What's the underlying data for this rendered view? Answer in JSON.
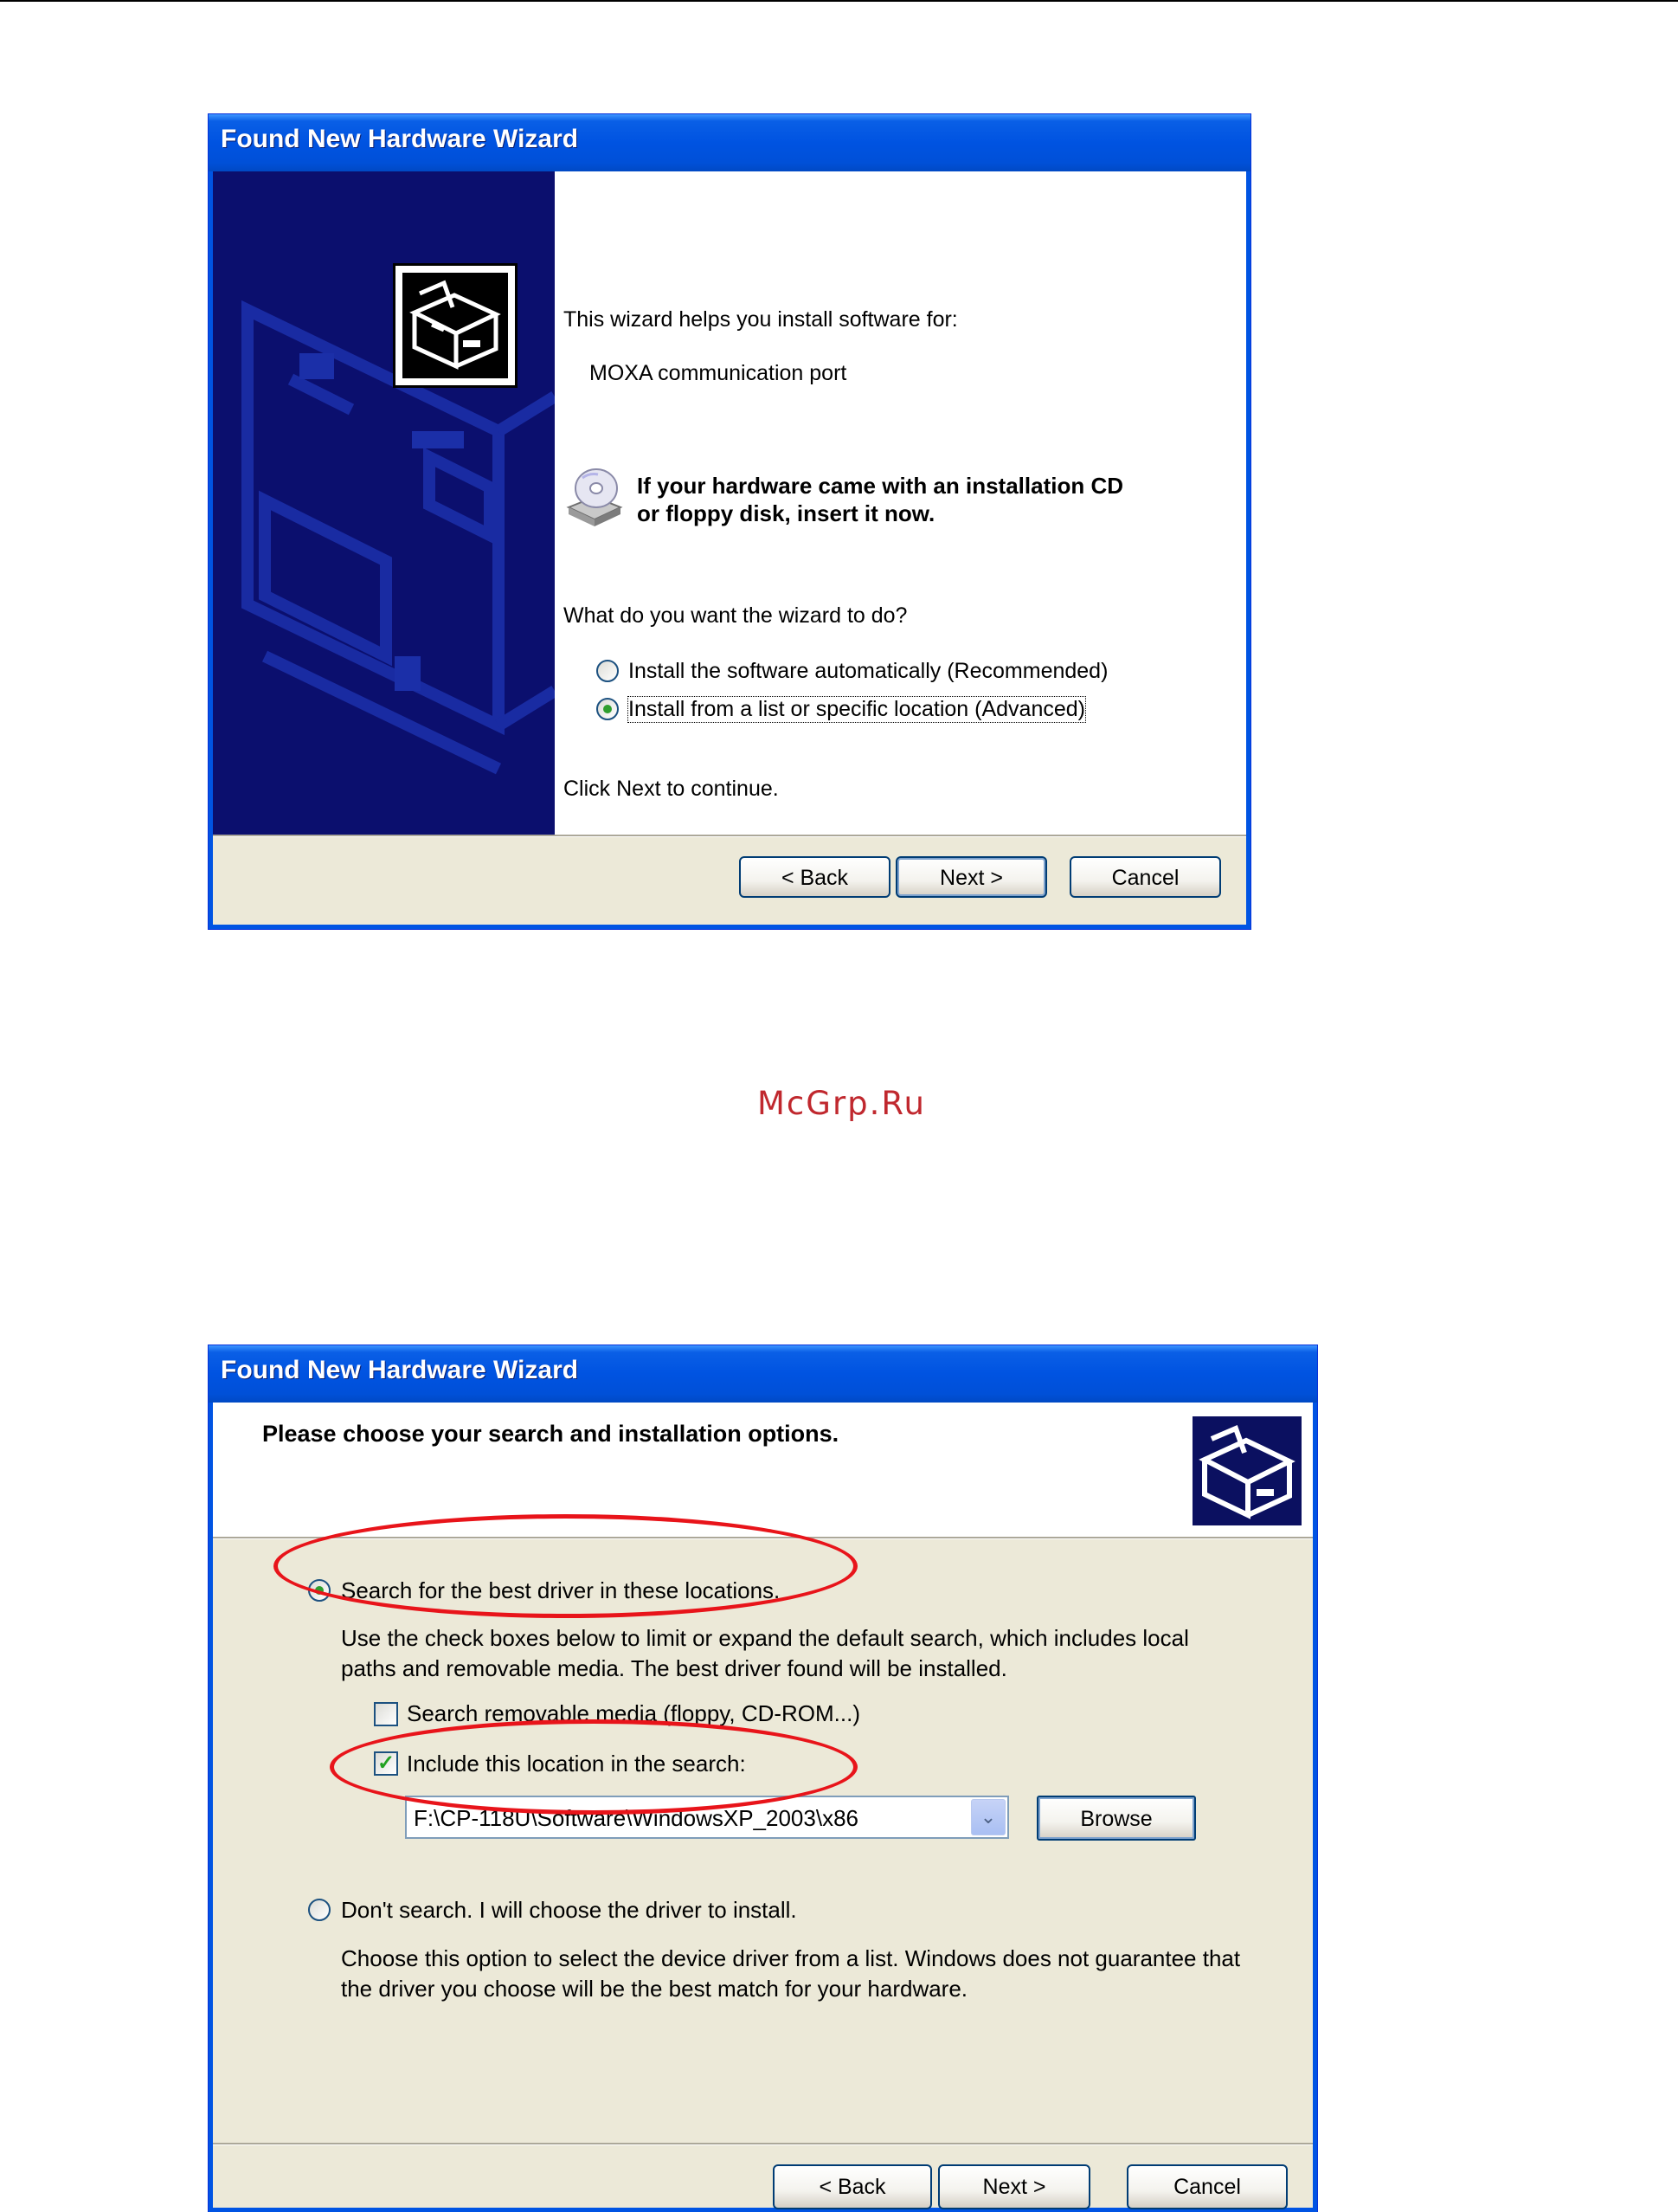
{
  "watermark": "McGrp.Ru",
  "dialog1": {
    "title": "Found New Hardware Wizard",
    "intro": "This wizard helps you install software for:",
    "device": "MOXA communication port",
    "cd_line1": "If your hardware came with an installation CD",
    "cd_line2": "or floppy disk, insert it now.",
    "question": "What do you want the wizard to do?",
    "option_auto": "Install the software automatically (Recommended)",
    "option_advanced": "Install from a list or specific location (Advanced)",
    "selected_option": "option_advanced",
    "continue": "Click Next to continue.",
    "back_label": "< Back",
    "next_label": "Next >",
    "cancel_label": "Cancel",
    "icons": [
      "hardware-box-icon",
      "cd-drive-icon"
    ]
  },
  "dialog2": {
    "title": "Found New Hardware Wizard",
    "heading": "Please choose your search and installation options.",
    "option_search": "Search for the best driver in these locations.",
    "search_desc_line1": "Use the check boxes below to limit or expand the default search, which includes local",
    "search_desc_line2": "paths and removable media. The best driver found will be installed.",
    "check_removable": "Search removable media (floppy, CD-ROM...)",
    "check_removable_checked": false,
    "check_location": "Include this location in the search:",
    "check_location_checked": true,
    "location_path": "F:\\CP-118U\\Software\\WindowsXP_2003\\x86",
    "browse_label": "Browse",
    "option_dont_search": "Don't search. I will choose the driver to install.",
    "dont_desc_line1": "Choose this option to select the device driver from a list.  Windows does not guarantee that",
    "dont_desc_line2": "the driver you choose will be the best match for your hardware.",
    "selected_option": "option_search",
    "back_label": "< Back",
    "next_label": "Next >",
    "cancel_label": "Cancel",
    "annotation_color": "#e8141a"
  }
}
